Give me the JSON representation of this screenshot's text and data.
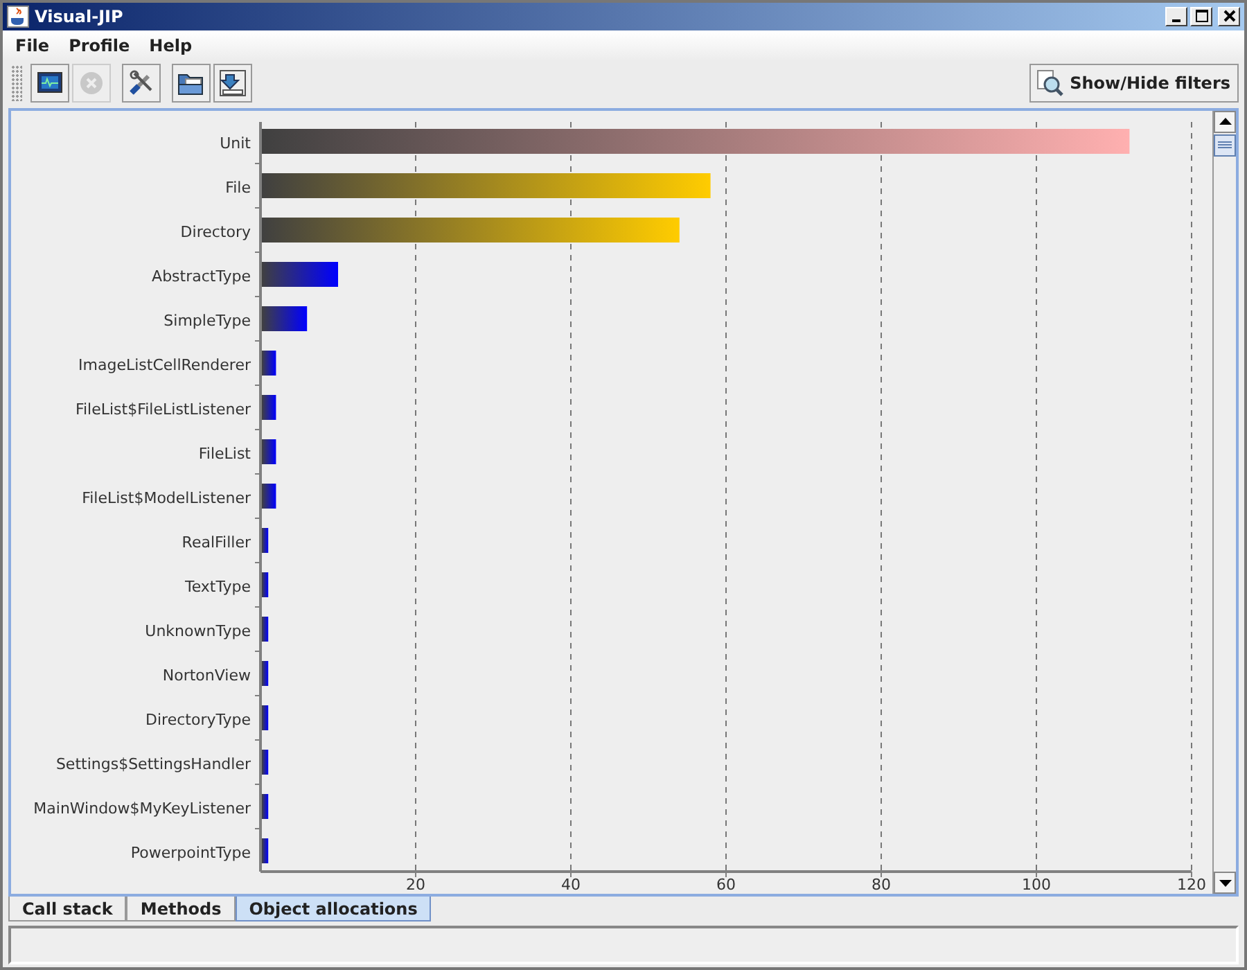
{
  "window": {
    "title": "Visual-JIP"
  },
  "menu": [
    "File",
    "Profile",
    "Help"
  ],
  "toolbar": [
    {
      "kind": "monitor",
      "disabled": false
    },
    {
      "kind": "stop",
      "disabled": true
    },
    {
      "kind": "tools",
      "disabled": false
    },
    {
      "kind": "open",
      "disabled": false
    },
    {
      "kind": "export",
      "disabled": false
    }
  ],
  "filters_button": {
    "label": "Show/Hide filters"
  },
  "chart_data": {
    "type": "bar",
    "orientation": "horizontal",
    "categories": [
      "Unit",
      "File",
      "Directory",
      "AbstractType",
      "SimpleType",
      "ImageListCellRenderer",
      "FileList$FileListListener",
      "FileList",
      "FileList$ModelListener",
      "RealFiller",
      "TextType",
      "UnknownType",
      "NortonView",
      "DirectoryType",
      "Settings$SettingsHandler",
      "MainWindow$MyKeyListener",
      "PowerpointType"
    ],
    "series": [
      {
        "color": "#ffb0b0",
        "values": [
          112,
          null,
          null,
          null,
          null,
          null,
          null,
          null,
          null,
          null,
          null,
          null,
          null,
          null,
          null,
          null,
          null
        ]
      },
      {
        "color": "#ffcc00",
        "values": [
          null,
          58,
          54,
          null,
          null,
          null,
          null,
          null,
          null,
          null,
          null,
          null,
          null,
          null,
          null,
          null,
          null
        ]
      },
      {
        "color": "#0000ff",
        "values": [
          null,
          null,
          null,
          10,
          6,
          2,
          2,
          2,
          2,
          1,
          1,
          1,
          1,
          1,
          1,
          1,
          1
        ]
      }
    ],
    "grid": true,
    "xlim": [
      0,
      120
    ],
    "xticks": [
      20,
      40,
      60,
      80,
      100,
      120
    ]
  },
  "tabs": [
    {
      "label": "Call stack",
      "selected": false
    },
    {
      "label": "Methods",
      "selected": false
    },
    {
      "label": "Object allocations",
      "selected": true
    }
  ]
}
